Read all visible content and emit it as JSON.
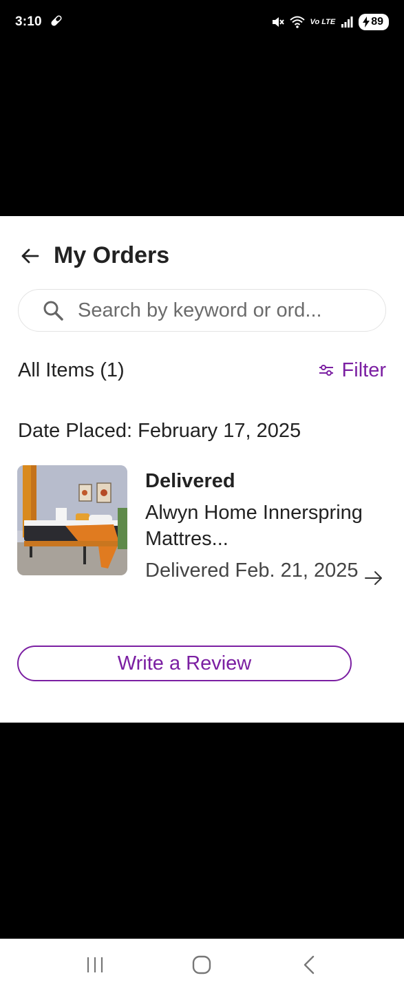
{
  "status_bar": {
    "time": "3:10",
    "network_label": "Vo LTE",
    "battery": "89",
    "icons": [
      "pill-icon",
      "mute-icon",
      "wifi-icon",
      "signal-icon",
      "battery-icon"
    ]
  },
  "header": {
    "title": "My Orders",
    "back_icon": "arrow-left-icon"
  },
  "search": {
    "placeholder": "Search by keyword or ord...",
    "value": ""
  },
  "items_bar": {
    "count_label": "All Items (1)",
    "filter_label": "Filter",
    "filter_icon": "sliders-icon"
  },
  "order": {
    "date_placed": "Date Placed: February 17, 2025",
    "status": "Delivered",
    "product_name": "Alwyn Home Innerspring Mattres...",
    "delivered_date": "Delivered Feb. 21, 2025",
    "arrow_icon": "arrow-right-icon",
    "review_label": "Write a Review"
  },
  "nav": {
    "icons": [
      "recents-icon",
      "home-icon",
      "back-icon"
    ]
  },
  "colors": {
    "accent": "#7b1fa2",
    "text": "#222222",
    "background": "#ffffff"
  }
}
